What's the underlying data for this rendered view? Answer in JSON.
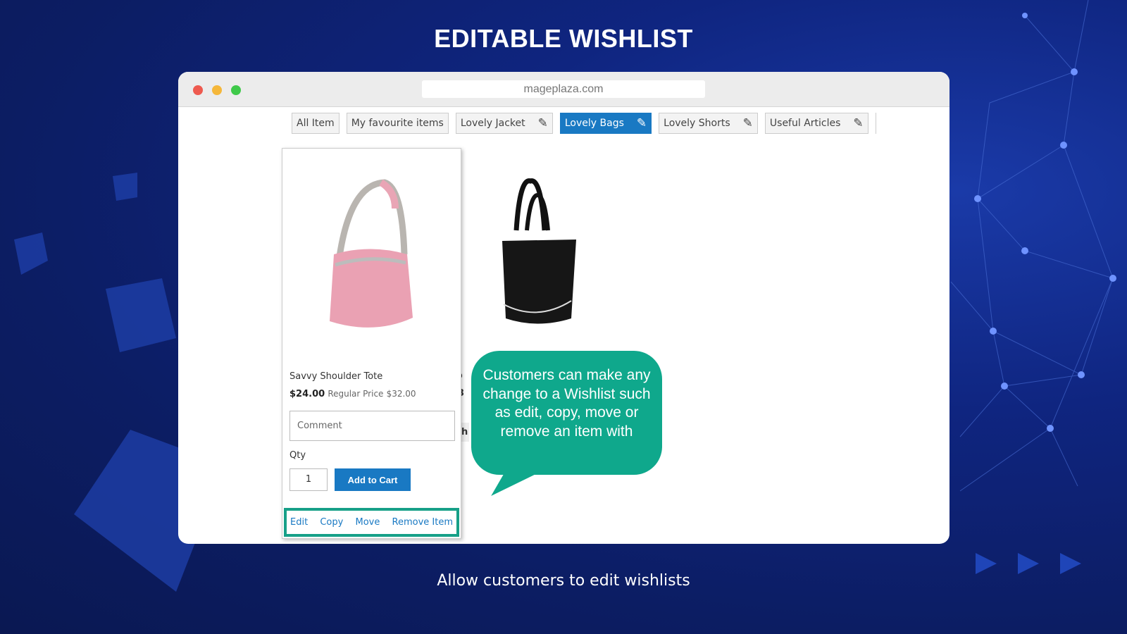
{
  "heading": "EDITABLE WISHLIST",
  "subtitle": "Allow customers to edit wishlists",
  "browser": {
    "url": "mageplaza.com"
  },
  "tabs": [
    {
      "label": "All Item",
      "editable": false
    },
    {
      "label": "My favourite items",
      "editable": false
    },
    {
      "label": "Lovely Jacket",
      "editable": true
    },
    {
      "label": "Lovely Bags",
      "editable": true,
      "active": true
    },
    {
      "label": "Lovely Shorts",
      "editable": true
    },
    {
      "label": "Useful Articles",
      "editable": true
    }
  ],
  "item": {
    "name": "Savvy Shoulder Tote",
    "price": "$24.00",
    "regular_price_label": "Regular Price",
    "regular_price": "$32.00",
    "comment_placeholder": "Comment",
    "qty_label": "Qty",
    "qty": "1",
    "add_to_cart": "Add to Cart",
    "actions": [
      "Edit",
      "Copy",
      "Move",
      "Remove Item"
    ]
  },
  "item2": {
    "name_partial": "Vo",
    "price_partial": "$3",
    "button_partial": "h"
  },
  "callout": "Customers can make any change to a Wishlist such as edit, copy, move or remove an item with",
  "colors": {
    "accent": "#1979c3",
    "highlight": "#17a088",
    "callout": "#0fa88c"
  }
}
